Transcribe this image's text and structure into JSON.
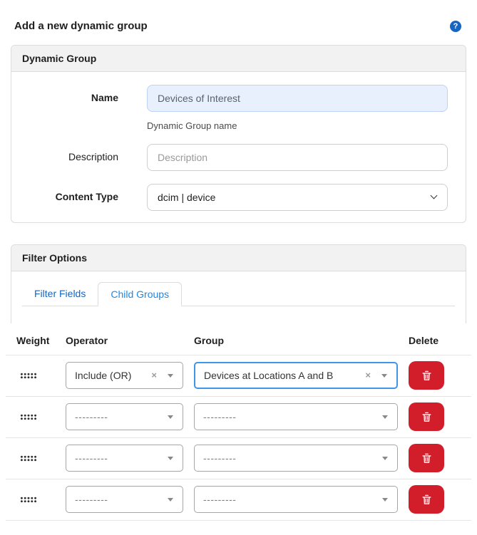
{
  "page": {
    "title": "Add a new dynamic group",
    "help_glyph": "?"
  },
  "dynamic_group_panel": {
    "title": "Dynamic Group",
    "name_label": "Name",
    "name_value": "Devices of Interest",
    "name_help": "Dynamic Group name",
    "description_label": "Description",
    "description_placeholder": "Description",
    "description_value": "",
    "content_type_label": "Content Type",
    "content_type_value": "dcim | device"
  },
  "filter_options_panel": {
    "title": "Filter Options",
    "tabs": [
      {
        "label": "Filter Fields",
        "active": false
      },
      {
        "label": "Child Groups",
        "active": true
      }
    ]
  },
  "child_groups_table": {
    "headers": [
      "Weight",
      "Operator",
      "Group",
      "Delete"
    ],
    "clear_glyph": "×",
    "rows": [
      {
        "operator": "Include (OR)",
        "group": "Devices at Locations A and B"
      },
      {
        "operator": "---------",
        "group": "---------"
      },
      {
        "operator": "---------",
        "group": "---------"
      },
      {
        "operator": "---------",
        "group": "---------"
      }
    ]
  },
  "colors": {
    "accent_blue": "#1665c0",
    "active_tab_blue": "#1e88e5",
    "inactive_tab_blue": "#1565c0",
    "focus_border_blue": "#3f95e8",
    "danger_red": "#d21e2b",
    "name_field_bg": "#e8f0fe",
    "panel_header_bg": "#f2f2f2",
    "panel_border": "#dcdcdc"
  }
}
